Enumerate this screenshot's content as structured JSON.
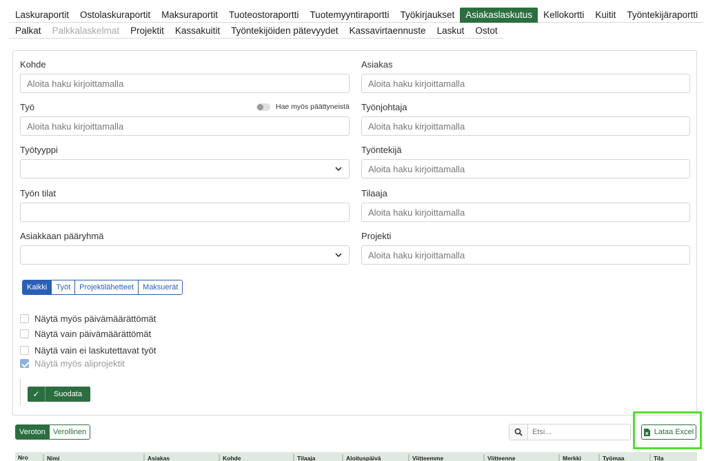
{
  "tabs_row1": [
    {
      "label": "Laskuraportit",
      "state": "normal"
    },
    {
      "label": "Ostolaskuraportit",
      "state": "normal"
    },
    {
      "label": "Maksuraportit",
      "state": "normal"
    },
    {
      "label": "Tuoteostoraportti",
      "state": "normal"
    },
    {
      "label": "Tuotemyyntiraportti",
      "state": "normal"
    },
    {
      "label": "Työkirjaukset",
      "state": "normal"
    },
    {
      "label": "Asiakaslaskutus",
      "state": "active"
    },
    {
      "label": "Kellokortti",
      "state": "normal"
    },
    {
      "label": "Kuitit",
      "state": "normal"
    },
    {
      "label": "Työntekijäraportti",
      "state": "normal"
    }
  ],
  "tabs_row2": [
    {
      "label": "Palkat",
      "state": "normal"
    },
    {
      "label": "Palkkalaskelmat",
      "state": "disabled"
    },
    {
      "label": "Projektit",
      "state": "normal"
    },
    {
      "label": "Kassakuitit",
      "state": "normal"
    },
    {
      "label": "Työntekijöiden pätevyydet",
      "state": "normal"
    },
    {
      "label": "Kassavirtaennuste",
      "state": "normal"
    },
    {
      "label": "Laskut",
      "state": "normal"
    },
    {
      "label": "Ostot",
      "state": "normal"
    }
  ],
  "form": {
    "kohde": {
      "label": "Kohde",
      "placeholder": "Aloita haku kirjoittamalla"
    },
    "asiakas": {
      "label": "Asiakas",
      "placeholder": "Aloita haku kirjoittamalla"
    },
    "tyo": {
      "label": "Työ",
      "placeholder": "Aloita haku kirjoittamalla",
      "toggle_label": "Hae myös päättyneistä"
    },
    "tyonjohtaja": {
      "label": "Työnjohtaja",
      "placeholder": "Aloita haku kirjoittamalla"
    },
    "tyotyyppi": {
      "label": "Työtyyppi",
      "value": ""
    },
    "tyontekija": {
      "label": "Työntekijä",
      "placeholder": "Aloita haku kirjoittamalla"
    },
    "tyon_tilat": {
      "label": "Työn tilat",
      "value": ""
    },
    "tilaaja": {
      "label": "Tilaaja",
      "placeholder": "Aloita haku kirjoittamalla"
    },
    "paaryhma": {
      "label": "Asiakkaan pääryhmä",
      "value": ""
    },
    "projekti": {
      "label": "Projekti",
      "placeholder": "Aloita haku kirjoittamalla"
    }
  },
  "type_filter": {
    "options": [
      "Kaikki",
      "Työt",
      "Projektilähetteet",
      "Maksuerät"
    ],
    "selected": "Kaikki"
  },
  "checkboxes": [
    {
      "label": "Näytä myös päivämäärättömät",
      "checked": false
    },
    {
      "label": "Näytä vain päivämäärättömät",
      "checked": false
    },
    {
      "label": "Näytä vain ei laskutettavat työt",
      "checked": false
    },
    {
      "label": "Näytä myös aliprojektit",
      "checked": true
    }
  ],
  "filter_button": {
    "label": "Suodata"
  },
  "tax_toggle": {
    "options": [
      "Veroton",
      "Verollinen"
    ],
    "selected": "Veroton"
  },
  "search": {
    "placeholder": "Etsi..."
  },
  "excel_button": {
    "label": "Lataa Excel"
  },
  "table": {
    "columns": [
      "Nro",
      "Nimi",
      "Asiakas",
      "Kohde",
      "Tilaaja",
      "Aloituspäivä",
      "Viitteemme",
      "Viitteenne",
      "Merkki",
      "Työmaa",
      "Tila"
    ]
  },
  "colors": {
    "accent_green": "#2b6e3f",
    "accent_blue": "#2a5fb8",
    "highlight": "#4fe02a"
  }
}
